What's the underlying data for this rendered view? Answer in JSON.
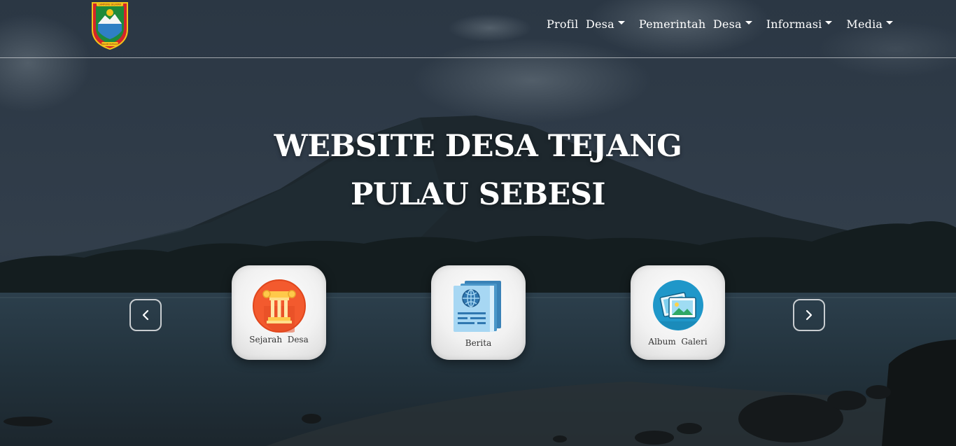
{
  "navbar": {
    "logo_name": "regency-emblem-logo",
    "logo_text_top": "LAMPUNG SELATAN",
    "logo_text_bottom": "RAGOM MUFAKAT",
    "menu": [
      {
        "label": "Profil  Desa",
        "icon": "caret-down-icon"
      },
      {
        "label": "Pemerintah  Desa",
        "icon": "caret-down-icon"
      },
      {
        "label": "Informasi",
        "icon": "caret-down-icon"
      },
      {
        "label": "Media",
        "icon": "caret-down-icon"
      }
    ]
  },
  "hero": {
    "title_line1": "WEBSITE DESA TEJANG",
    "title_line2": "PULAU SEBESI"
  },
  "carousel": {
    "prev_icon": "chevron-left-icon",
    "next_icon": "chevron-right-icon",
    "cards": [
      {
        "label": "Sejarah  Desa",
        "icon": "history-pillar-icon"
      },
      {
        "label": "Berita",
        "icon": "news-document-icon"
      },
      {
        "label": "Album  Galeri",
        "icon": "photo-gallery-icon"
      }
    ]
  },
  "colors": {
    "overlay": "#1b2530",
    "text": "#ffffff",
    "card_bg": "#f1f1f1"
  }
}
